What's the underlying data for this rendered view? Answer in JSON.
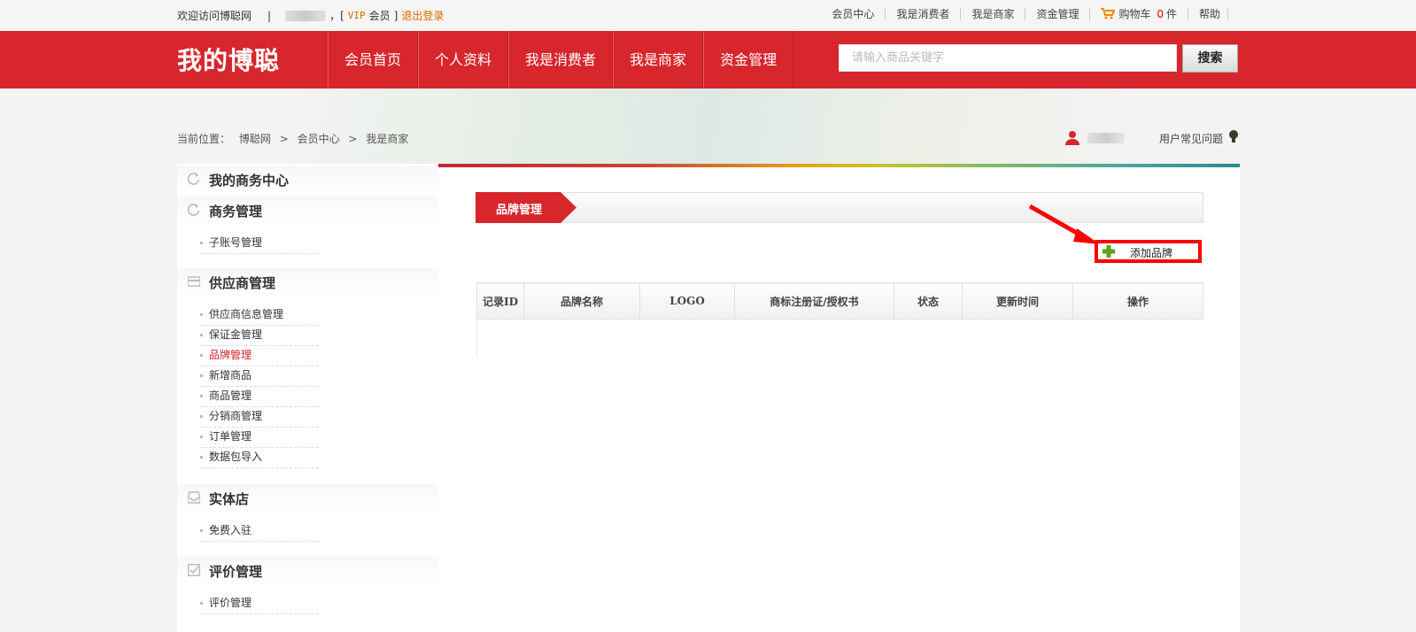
{
  "topbar": {
    "welcome": "欢迎访问博聪网",
    "separator": "|",
    "bracket_open": "，[",
    "vip": "VIP",
    "member": "会员",
    "bracket_close": "]",
    "logout": "退出登录",
    "links": [
      "会员中心",
      "我是消费者",
      "我是商家",
      "资金管理"
    ],
    "cart_label": "购物车",
    "cart_count": "0",
    "cart_unit": "件",
    "help": "帮助"
  },
  "nav": {
    "logo": "我的博聪",
    "items": [
      "会员首页",
      "个人资料",
      "我是消费者",
      "我是商家",
      "资金管理"
    ],
    "search_placeholder": "请输入商品关键字",
    "search_button": "搜索"
  },
  "breadcrumb": {
    "prefix": "当前位置：",
    "items": [
      "博聪网",
      "会员中心",
      "我是商家"
    ],
    "sep": ">"
  },
  "user": {
    "faq": "用户常见问题"
  },
  "sidebar": {
    "sections": [
      {
        "title": "我的商务中心",
        "icon": "refresh-icon"
      },
      {
        "title": "商务管理",
        "icon": "refresh-icon",
        "items": [
          "子账号管理"
        ]
      },
      {
        "title": "供应商管理",
        "icon": "card-icon",
        "items": [
          "供应商信息管理",
          "保证金管理",
          "品牌管理",
          "新增商品",
          "商品管理",
          "分销商管理",
          "订单管理",
          "数据包导入"
        ]
      },
      {
        "title": "实体店",
        "icon": "tray-icon",
        "items": [
          "免费入驻"
        ]
      },
      {
        "title": "评价管理",
        "icon": "check-icon",
        "items": [
          "评价管理"
        ]
      }
    ],
    "active_item": "品牌管理"
  },
  "main": {
    "panel_title": "品牌管理",
    "add_button": "添加品牌",
    "columns": [
      "记录ID",
      "品牌名称",
      "LOGO",
      "商标注册证/授权书",
      "状态",
      "更新时间",
      "操作"
    ]
  },
  "colors": {
    "brand_red": "#d7262c",
    "accent_orange": "#e06a00",
    "annotation_red": "#ff0000"
  }
}
